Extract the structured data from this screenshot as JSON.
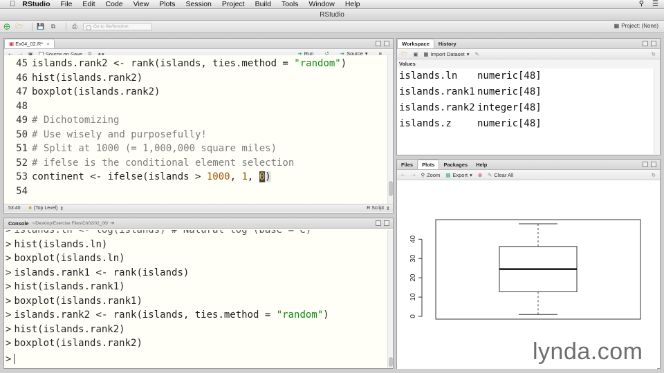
{
  "menu": {
    "app_name": "RStudio",
    "items": [
      "File",
      "Edit",
      "Code",
      "View",
      "Plots",
      "Session",
      "Project",
      "Build",
      "Tools",
      "Window",
      "Help"
    ]
  },
  "window": {
    "title": "RStudio"
  },
  "toolbar": {
    "goto_placeholder": "Go to file/function",
    "project_label": "Project: (None)"
  },
  "editor": {
    "tab_label": "Ex04_02.R*",
    "source_on_save": "Source on Save",
    "run_label": "Run",
    "source_label": "Source",
    "status_position": "53:40",
    "status_scope": "(Top Level)",
    "status_type": "R Script",
    "lines": [
      {
        "n": "45",
        "a": "islands.rank2 <- rank(islands, ties.method = ",
        "s": "\"random\"",
        "b": ")"
      },
      {
        "n": "46",
        "a": "hist(islands.rank2)"
      },
      {
        "n": "47",
        "a": "boxplot(islands.rank2)"
      },
      {
        "n": "48",
        "a": ""
      },
      {
        "n": "49",
        "c": "# Dichotomizing"
      },
      {
        "n": "50",
        "c": "# Use wisely and purposefully!"
      },
      {
        "n": "51",
        "c": "# Split at 1000 (= 1,000,000 square miles)"
      },
      {
        "n": "52",
        "c": "# ifelse is the conditional element selection"
      },
      {
        "n": "53",
        "a": "continent <- ifelse(islands > ",
        "num1": "1000",
        "mid": ", ",
        "num2": "1",
        "end": ", ",
        "sel": "0",
        "close": ")"
      },
      {
        "n": "54",
        "a": ""
      }
    ]
  },
  "console": {
    "tab_label": "Console",
    "path": "~/Desktop/Exercise Files/Ch02/02_06/",
    "partial_line": "islands.ln <- log(islands) # Natural log (base = e)",
    "lines": [
      {
        "a": "hist(islands.ln)"
      },
      {
        "a": "boxplot(islands.ln)"
      },
      {
        "a": "islands.rank1 <- rank(islands)"
      },
      {
        "a": "hist(islands.rank1)"
      },
      {
        "a": "boxplot(islands.rank1)"
      },
      {
        "a": "islands.rank2 <- rank(islands, ties.method = ",
        "s": "\"random\"",
        "b": ")"
      },
      {
        "a": "hist(islands.rank2)"
      },
      {
        "a": "boxplot(islands.rank2)"
      }
    ],
    "prompt": ">"
  },
  "workspace": {
    "tabs": [
      "Workspace",
      "History"
    ],
    "import_label": "Import Dataset",
    "section_label": "Values",
    "values": [
      {
        "name": "islands.ln",
        "value": "numeric[48]"
      },
      {
        "name": "islands.rank1",
        "value": "numeric[48]"
      },
      {
        "name": "islands.rank2",
        "value": "integer[48]"
      },
      {
        "name": "islands.z",
        "value": "numeric[48]"
      }
    ]
  },
  "plots_pane": {
    "tabs": [
      "Files",
      "Plots",
      "Packages",
      "Help"
    ],
    "zoom_label": "Zoom",
    "export_label": "Export",
    "clear_label": "Clear All"
  },
  "chart_data": {
    "type": "boxplot",
    "title": "",
    "xlabel": "",
    "ylabel": "",
    "ylim": [
      0,
      50
    ],
    "yticks": [
      "0",
      "10",
      "20",
      "30",
      "40"
    ],
    "stats": {
      "min": 1,
      "q1": 12.75,
      "median": 24.5,
      "q3": 36.25,
      "max": 48
    }
  },
  "watermark": {
    "text": "lynda.com"
  },
  "colors": {
    "string": "#0f8a0f",
    "number": "#9a4f00",
    "comment": "#7d7d7d",
    "editor_bg": "#fffff8"
  }
}
